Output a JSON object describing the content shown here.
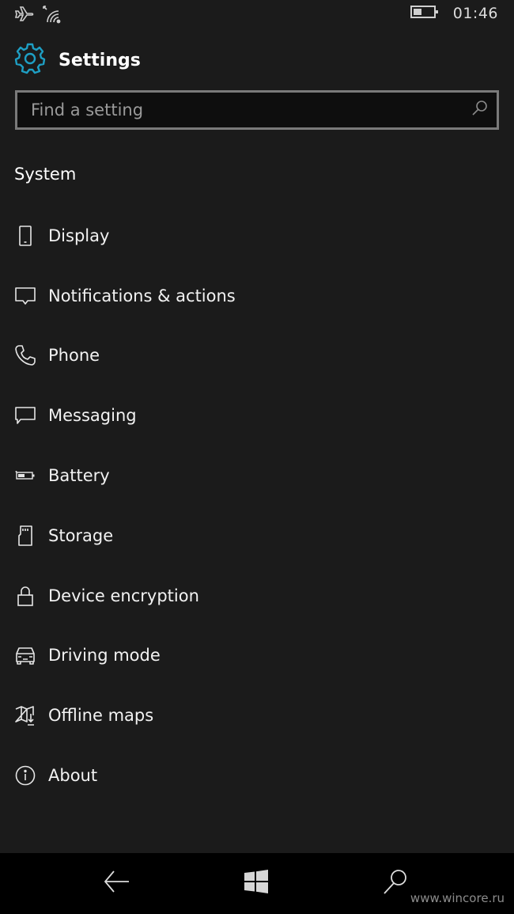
{
  "status_bar": {
    "icons": [
      "airplane-mode-icon",
      "wifi-icon",
      "battery-icon"
    ],
    "time": "01:46"
  },
  "header": {
    "icon": "gear-icon",
    "title": "Settings",
    "accent_color": "#1e9fc4"
  },
  "search": {
    "placeholder": "Find a setting",
    "value": "",
    "icon": "search-icon"
  },
  "section": {
    "title": "System"
  },
  "menu": {
    "items": [
      {
        "label": "Display",
        "icon": "phone-display-icon"
      },
      {
        "label": "Notifications & actions",
        "icon": "notification-icon"
      },
      {
        "label": "Phone",
        "icon": "phone-handset-icon"
      },
      {
        "label": "Messaging",
        "icon": "message-icon"
      },
      {
        "label": "Battery",
        "icon": "battery-icon"
      },
      {
        "label": "Storage",
        "icon": "sd-card-icon"
      },
      {
        "label": "Device encryption",
        "icon": "lock-icon"
      },
      {
        "label": "Driving mode",
        "icon": "car-icon"
      },
      {
        "label": "Offline maps",
        "icon": "map-download-icon"
      },
      {
        "label": "About",
        "icon": "info-icon"
      }
    ]
  },
  "nav_bar": {
    "back": "back-arrow-icon",
    "home": "windows-logo-icon",
    "search": "search-icon"
  },
  "watermark": "www.wincore.ru"
}
